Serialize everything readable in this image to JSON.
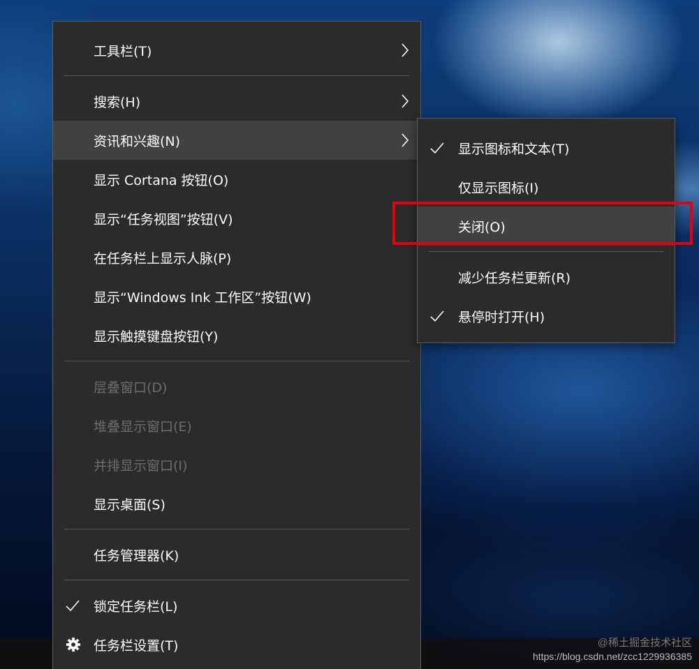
{
  "main_menu": {
    "toolbars": "工具栏(T)",
    "search": "搜索(H)",
    "news_interests": "资讯和兴趣(N)",
    "show_cortana": "显示 Cortana 按钮(O)",
    "show_task_view": "显示“任务视图”按钮(V)",
    "show_people": "在任务栏上显示人脉(P)",
    "show_ink": "显示“Windows Ink 工作区”按钮(W)",
    "show_touch_keyboard": "显示触摸键盘按钮(Y)",
    "cascade": "层叠窗口(D)",
    "stack": "堆叠显示窗口(E)",
    "side_by_side": "并排显示窗口(I)",
    "show_desktop": "显示桌面(S)",
    "task_manager": "任务管理器(K)",
    "lock_taskbar": "锁定任务栏(L)",
    "taskbar_settings": "任务栏设置(T)"
  },
  "sub_menu": {
    "show_icon_text": "显示图标和文本(T)",
    "show_icon_only": "仅显示图标(I)",
    "turn_off": "关闭(O)",
    "reduce_updates": "减少任务栏更新(R)",
    "open_on_hover": "悬停时打开(H)"
  },
  "watermark": {
    "line1": "@稀土掘金技术社区",
    "line2": "https://blog.csdn.net/zcc1229936385"
  },
  "icons": {
    "submenu_arrow": "chevron-right-icon",
    "checked": "checkmark-icon",
    "settings": "gear-icon"
  },
  "colors": {
    "menu_bg": "#2b2b2b",
    "hover_bg": "#414141",
    "disabled_text": "#6d6d6d",
    "highlight_border": "#e4000e"
  },
  "state": {
    "lock_taskbar_checked": true,
    "show_icon_text_checked": true,
    "open_on_hover_checked": true
  }
}
